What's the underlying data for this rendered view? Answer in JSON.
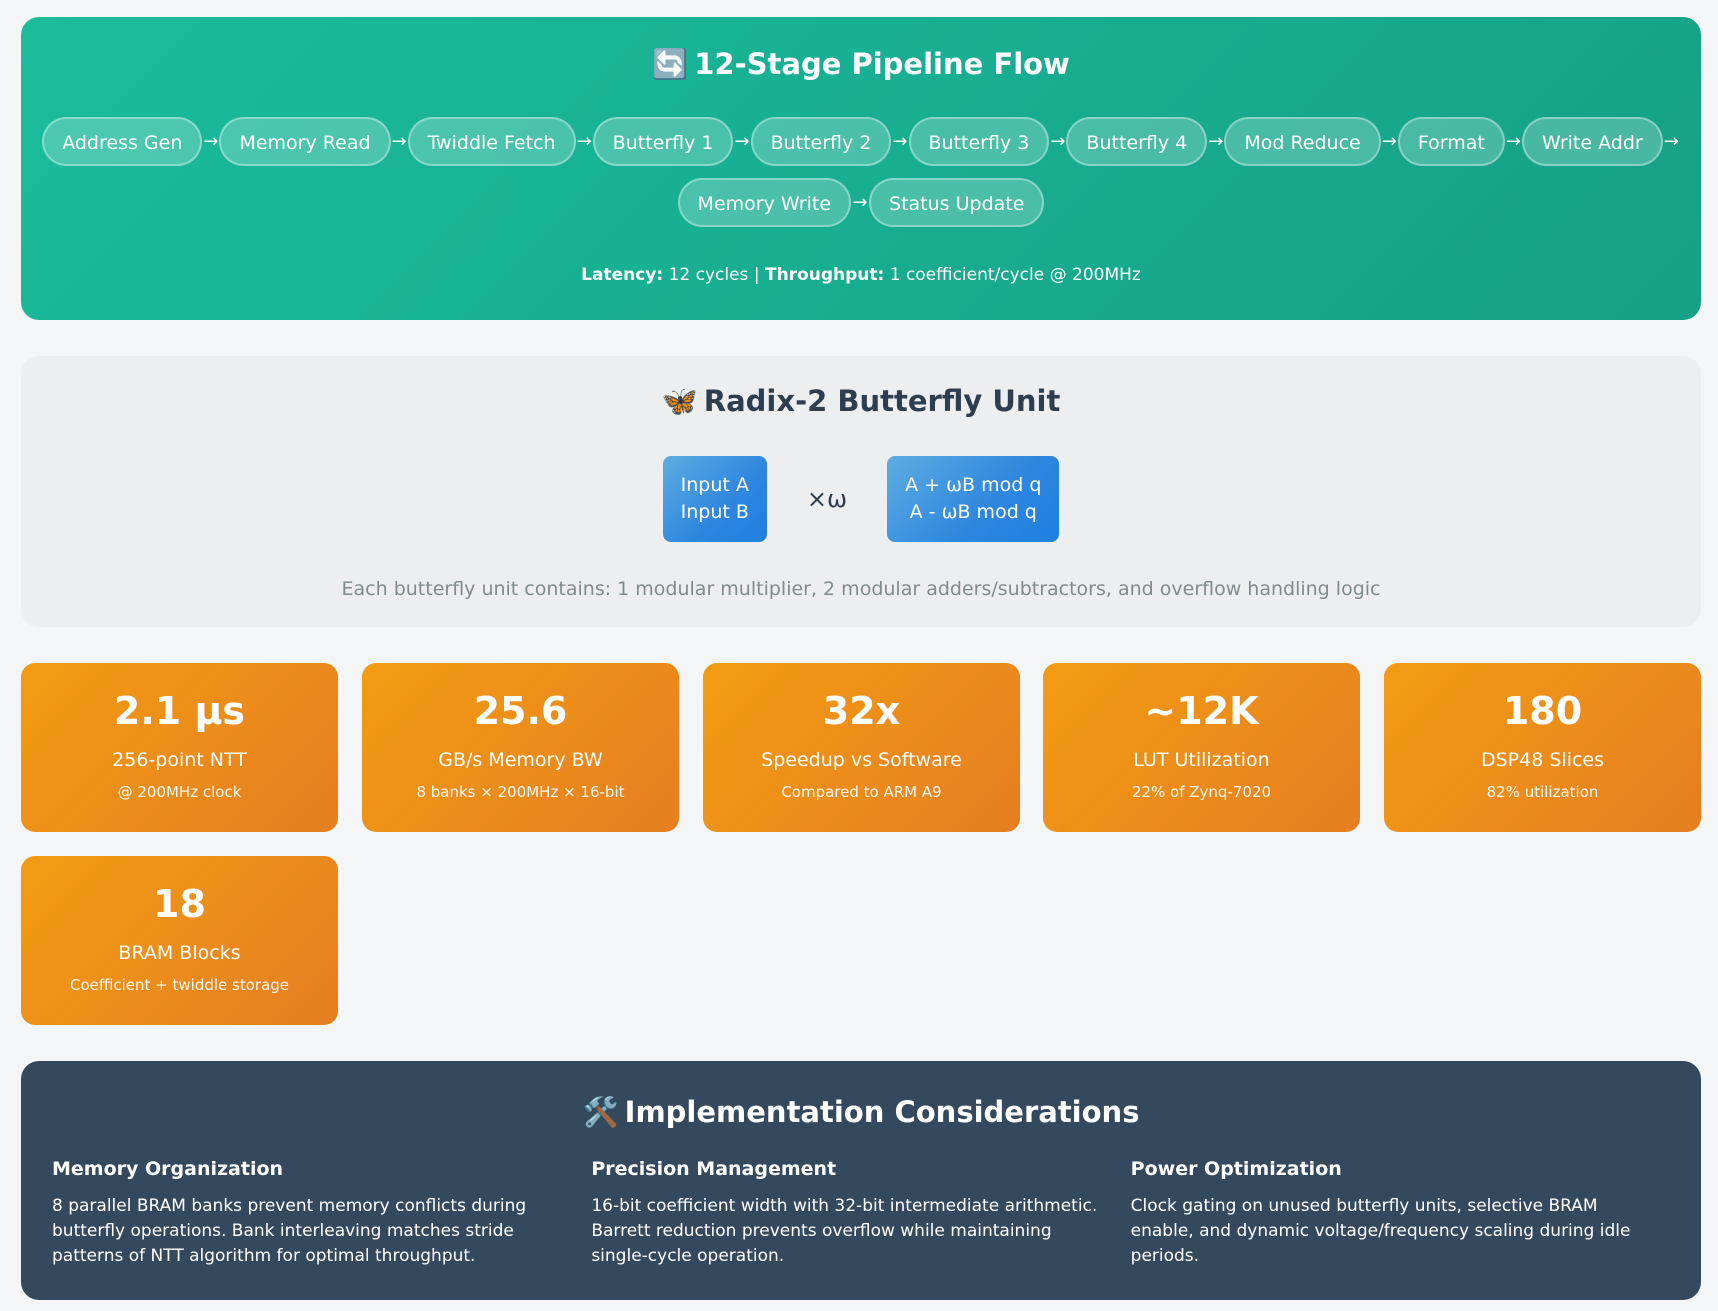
{
  "pipeline": {
    "icon": "🔄",
    "title": "12-Stage Pipeline Flow",
    "stages": [
      "Address Gen",
      "Memory Read",
      "Twiddle Fetch",
      "Butterfly 1",
      "Butterfly 2",
      "Butterfly 3",
      "Butterfly 4",
      "Mod Reduce",
      "Format",
      "Write Addr",
      "Memory Write",
      "Status Update"
    ],
    "arrow": "→",
    "latency_label": "Latency:",
    "latency_value": "12 cycles",
    "separator": "|",
    "throughput_label": "Throughput:",
    "throughput_value": "1 coefficient/cycle @ 200MHz"
  },
  "butterfly": {
    "icon": "🦋",
    "title": "Radix-2 Butterfly Unit",
    "input_a": "Input A",
    "input_b": "Input B",
    "operator": "×ω",
    "output_1": "A + ωB mod q",
    "output_2": "A - ωB mod q",
    "note": "Each butterfly unit contains: 1 modular multiplier, 2 modular adders/subtractors, and overflow handling logic"
  },
  "metrics": [
    {
      "value": "2.1 μs",
      "label": "256-point NTT",
      "sub": "@ 200MHz clock"
    },
    {
      "value": "25.6",
      "label": "GB/s Memory BW",
      "sub": "8 banks × 200MHz × 16-bit"
    },
    {
      "value": "32x",
      "label": "Speedup vs Software",
      "sub": "Compared to ARM A9"
    },
    {
      "value": "~12K",
      "label": "LUT Utilization",
      "sub": "22% of Zynq-7020"
    },
    {
      "value": "180",
      "label": "DSP48 Slices",
      "sub": "82% utilization"
    },
    {
      "value": "18",
      "label": "BRAM Blocks",
      "sub": "Coefficient + twiddle storage"
    }
  ],
  "implementation": {
    "icon": "🛠️",
    "title": "Implementation Considerations",
    "columns": [
      {
        "heading": "Memory Organization",
        "text": "8 parallel BRAM banks prevent memory conflicts during butterfly operations. Bank interleaving matches stride patterns of NTT algorithm for optimal throughput."
      },
      {
        "heading": "Precision Management",
        "text": "16-bit coefficient width with 32-bit intermediate arithmetic. Barrett reduction prevents overflow while maintaining single-cycle operation."
      },
      {
        "heading": "Power Optimization",
        "text": "Clock gating on unused butterfly units, selective BRAM enable, and dynamic voltage/frequency scaling during idle periods."
      }
    ]
  }
}
